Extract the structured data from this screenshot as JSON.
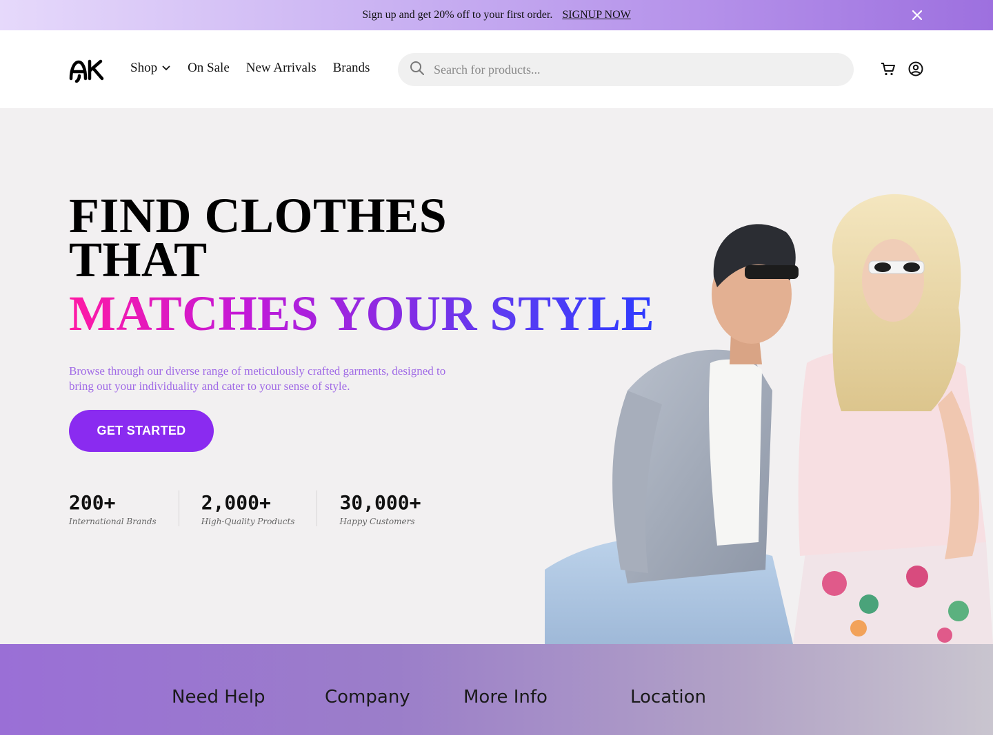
{
  "announcement": {
    "text": "Sign up and get 20% off to your first order.",
    "link_label": "SIGNUP NOW"
  },
  "header": {
    "logo_text": "AK",
    "nav": [
      {
        "label": "Shop",
        "has_dropdown": true
      },
      {
        "label": "On Sale"
      },
      {
        "label": "New Arrivals"
      },
      {
        "label": "Brands"
      }
    ],
    "search": {
      "placeholder": "Search for products...",
      "value": ""
    },
    "icons": [
      "cart-icon",
      "account-icon"
    ]
  },
  "hero": {
    "headline_line1": "FIND CLOTHES",
    "headline_line2": "THAT",
    "headline_gradient": "MATCHES YOUR STYLE",
    "description": "Browse through our diverse range of meticulously crafted garments, designed to bring out your individuality and cater to your sense of style.",
    "cta_label": "GET STARTED",
    "stats": [
      {
        "value": "200+",
        "label": "International Brands"
      },
      {
        "value": "2,000+",
        "label": "High-Quality Products"
      },
      {
        "value": "30,000+",
        "label": "Happy Customers"
      }
    ]
  },
  "footer": {
    "columns": [
      "Need Help",
      "Company",
      "More Info",
      "Location"
    ]
  },
  "colors": {
    "accent": "#8a2bf0",
    "gradient_start": "#ff1aa4",
    "gradient_end": "#2d3bff",
    "hero_bg": "#f2f0f1"
  }
}
